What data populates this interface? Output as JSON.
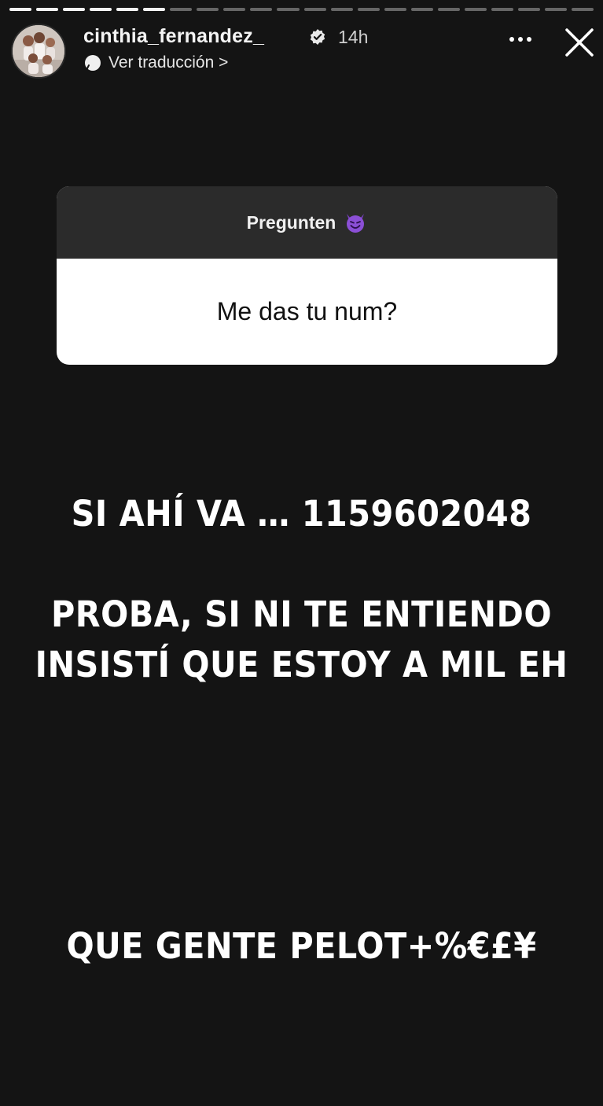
{
  "progress": {
    "total_segments": 22,
    "completed_segments": 6
  },
  "header": {
    "username": "cinthia_fernandez_",
    "time_ago": "14h",
    "translate_label": "Ver traducción >",
    "verified_icon": "verified-badge-icon",
    "more_icon": "more-options-icon",
    "close_icon": "close-icon"
  },
  "question_sticker": {
    "title": "Pregunten",
    "emoji_icon": "smiling-devil-emoji",
    "answer": "Me das tu num?"
  },
  "story_texts": {
    "line1": "SI AHÍ VA … 1159602048",
    "line2": "PROBA, SI NI TE ENTIENDO",
    "line3": "INSISTÍ QUE ESTOY A MIL EH",
    "line4": "QUE GENTE PELOT+%€£¥"
  },
  "colors": {
    "background": "#141414",
    "sticker_header": "#2b2b2b",
    "emoji_purple": "#8b4fd6"
  }
}
